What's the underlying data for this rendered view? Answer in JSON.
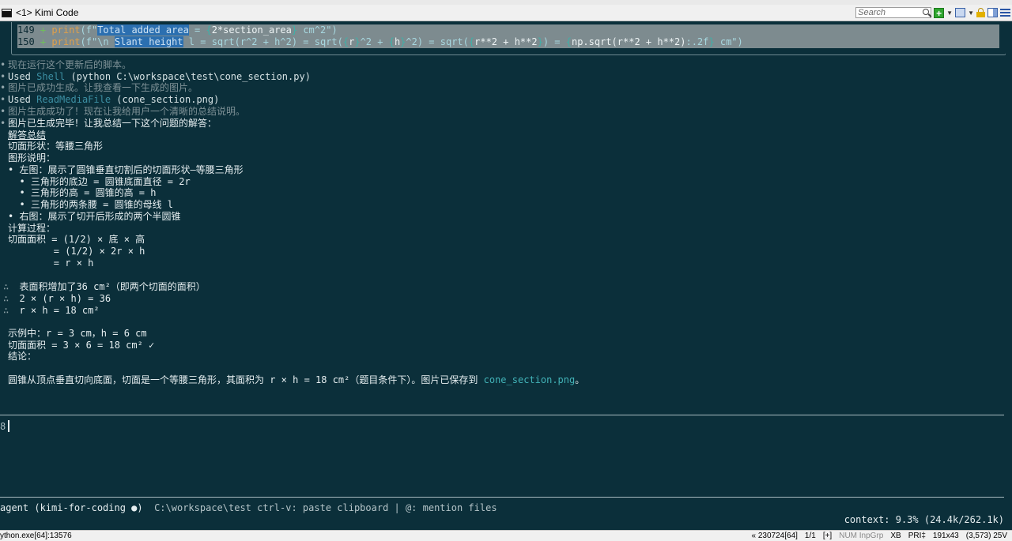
{
  "window": {
    "tab_label": "<1> Kimi Code"
  },
  "toolbar": {
    "search_placeholder": "Search"
  },
  "code": {
    "line149": {
      "num": "149",
      "plus": "+",
      "fn": "print",
      "p1": "(f\"",
      "sel": "Total added area",
      "p2": " = ",
      "b1": "{",
      "expr": "2*section_area",
      "b2": "}",
      "p3": " cm^2\")"
    },
    "line150": {
      "num": "150",
      "plus": "+",
      "fn": "print",
      "p1": "(f\"\\n ",
      "sel": "Slant height",
      "p2": " l = sqrt(r^2 + h^2) = sqrt(",
      "b1": "{",
      "r": "r",
      "b2": "}",
      "p3": "^2 + ",
      "b3": "{",
      "h": "h",
      "b4": "}",
      "p4": "^2) = sqrt(",
      "b5": "{",
      "e1": "r**2 + h**2",
      "b6": "}",
      "p5": ") = ",
      "b7": "{",
      "e2": "np.sqrt(r**2 + h**2)",
      "p6": ":.2f",
      "b8": "}",
      "p7": " cm\")"
    }
  },
  "transcript": {
    "l1": "现在运行这个更新后的脚本。",
    "l2_used": "Used",
    "l2_tool": "Shell",
    "l2_arg": "(python C:\\workspace\\test\\cone_section.py)",
    "l3": "图片已成功生成。让我查看一下生成的图片。",
    "l4_used": "Used",
    "l4_tool": "ReadMediaFile",
    "l4_arg": "(cone_section.png)",
    "l5": "图片生成成功了！现在让我给用户一个清晰的总结说明。",
    "l6": "图片已生成完毕！让我总结一下这个问题的解答：",
    "heading": "解答总结",
    "shape": "切面形状：等腰三角形",
    "desc": "图形说明：",
    "left": "• 左图：展示了圆锥垂直切割后的切面形状—等腰三角形",
    "left_a": "  • 三角形的底边 = 圆锥底面直径 = 2r",
    "left_b": "  • 三角形的高 = 圆锥的高 = h",
    "left_c": "  • 三角形的两条腰 = 圆锥的母线 l",
    "right": "• 右图：展示了切开后形成的两个半圆锥",
    "calc": "计算过程：",
    "calc1": "切面面积 = (1/2) × 底 × 高",
    "calc2": "        = (1/2) × 2r × h",
    "calc3": "        = r × h",
    "fact1": "  表面积增加了36 cm²（即两个切面的面积）",
    "fact2": "  2 × (r × h) = 36",
    "fact3": "  r × h = 18 cm²",
    "example1": "示例中：r = 3 cm，h = 6 cm",
    "example2": "切面面积 = 3 × 6 = 18 cm² ✓",
    "conclusion": "结论：",
    "final_a": "圆锥从顶点垂直切向底面，切面是一个等腰三角形，其面积为 ",
    "final_b": "r × h = 18 cm²",
    "final_c": "（题目条件下）。图片已保存到 ",
    "final_file": "cone_section.png",
    "final_d": "。"
  },
  "bullets": {
    "b1": "•",
    "b2": "•",
    "b3": "•",
    "b4": "•",
    "b5": "•",
    "b6": "•",
    "t1": "∴",
    "t2": "∴",
    "t3": "∴"
  },
  "prompt": {
    "char": "8"
  },
  "footer": {
    "agent": "agent (kimi-for-coding ●)",
    "hint": "C:\\workspace\\test ctrl-v: paste clipboard | @: mention files",
    "context": "context: 9.3% (24.4k/262.1k)"
  },
  "statusbar": {
    "process": "ython.exe[64]:13576",
    "pos": "« 230724[64]",
    "pages": "1/1",
    "mode": "[+]",
    "flags": "NUM InpGrp",
    "xb": "XB",
    "pri": "PRI‡",
    "size": "191x43",
    "coords": "(3,573) 25V"
  }
}
